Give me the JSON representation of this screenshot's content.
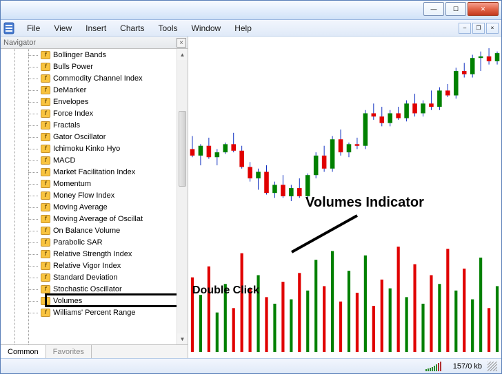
{
  "window": {
    "minimize": "—",
    "maximize": "☐",
    "close": "✕"
  },
  "menu": {
    "items": [
      "File",
      "View",
      "Insert",
      "Charts",
      "Tools",
      "Window",
      "Help"
    ]
  },
  "mdi": {
    "min": "–",
    "restore": "❐",
    "close": "×"
  },
  "navigator": {
    "title": "Navigator",
    "close": "×",
    "tabs": {
      "common": "Common",
      "favorites": "Favorites"
    },
    "indicators": [
      "Bollinger Bands",
      "Bulls Power",
      "Commodity Channel Index",
      "DeMarker",
      "Envelopes",
      "Force Index",
      "Fractals",
      "Gator Oscillator",
      "Ichimoku Kinko Hyo",
      "MACD",
      "Market Facilitation Index",
      "Momentum",
      "Money Flow Index",
      "Moving Average",
      "Moving Average of Oscillat",
      "On Balance Volume",
      "Parabolic SAR",
      "Relative Strength Index",
      "Relative Vigor Index",
      "Standard Deviation",
      "Stochastic Oscillator",
      "Volumes",
      "Williams' Percent Range"
    ],
    "selected": "Volumes"
  },
  "annotations": {
    "title": "Volumes Indicator",
    "hint": "Double Click"
  },
  "status": {
    "label": "157/0 kb"
  },
  "chart_data": [
    {
      "type": "candlestick",
      "title": "",
      "colors": {
        "up": "#008000",
        "down": "#e00000",
        "wick": "#1030c0"
      },
      "candles": [
        {
          "o": 60,
          "h": 68,
          "l": 55,
          "c": 56,
          "dir": "down"
        },
        {
          "o": 56,
          "h": 63,
          "l": 50,
          "c": 62,
          "dir": "up"
        },
        {
          "o": 62,
          "h": 67,
          "l": 54,
          "c": 55,
          "dir": "down"
        },
        {
          "o": 55,
          "h": 60,
          "l": 50,
          "c": 58,
          "dir": "up"
        },
        {
          "o": 58,
          "h": 64,
          "l": 57,
          "c": 63,
          "dir": "up"
        },
        {
          "o": 63,
          "h": 70,
          "l": 58,
          "c": 59,
          "dir": "down"
        },
        {
          "o": 59,
          "h": 62,
          "l": 48,
          "c": 49,
          "dir": "down"
        },
        {
          "o": 49,
          "h": 52,
          "l": 40,
          "c": 42,
          "dir": "down"
        },
        {
          "o": 42,
          "h": 48,
          "l": 35,
          "c": 46,
          "dir": "up"
        },
        {
          "o": 46,
          "h": 50,
          "l": 32,
          "c": 33,
          "dir": "down"
        },
        {
          "o": 33,
          "h": 40,
          "l": 30,
          "c": 38,
          "dir": "up"
        },
        {
          "o": 38,
          "h": 44,
          "l": 30,
          "c": 31,
          "dir": "down"
        },
        {
          "o": 31,
          "h": 38,
          "l": 28,
          "c": 36,
          "dir": "up"
        },
        {
          "o": 36,
          "h": 42,
          "l": 30,
          "c": 31,
          "dir": "down"
        },
        {
          "o": 31,
          "h": 45,
          "l": 29,
          "c": 44,
          "dir": "up"
        },
        {
          "o": 44,
          "h": 58,
          "l": 42,
          "c": 56,
          "dir": "up"
        },
        {
          "o": 56,
          "h": 62,
          "l": 46,
          "c": 48,
          "dir": "down"
        },
        {
          "o": 48,
          "h": 68,
          "l": 46,
          "c": 66,
          "dir": "up"
        },
        {
          "o": 66,
          "h": 72,
          "l": 56,
          "c": 58,
          "dir": "down"
        },
        {
          "o": 58,
          "h": 64,
          "l": 55,
          "c": 63,
          "dir": "up"
        },
        {
          "o": 63,
          "h": 67,
          "l": 60,
          "c": 62,
          "dir": "down"
        },
        {
          "o": 62,
          "h": 84,
          "l": 60,
          "c": 82,
          "dir": "up"
        },
        {
          "o": 82,
          "h": 88,
          "l": 78,
          "c": 80,
          "dir": "down"
        },
        {
          "o": 80,
          "h": 86,
          "l": 74,
          "c": 76,
          "dir": "down"
        },
        {
          "o": 76,
          "h": 84,
          "l": 74,
          "c": 82,
          "dir": "up"
        },
        {
          "o": 82,
          "h": 86,
          "l": 78,
          "c": 79,
          "dir": "down"
        },
        {
          "o": 79,
          "h": 90,
          "l": 77,
          "c": 88,
          "dir": "up"
        },
        {
          "o": 88,
          "h": 94,
          "l": 80,
          "c": 82,
          "dir": "down"
        },
        {
          "o": 82,
          "h": 90,
          "l": 80,
          "c": 88,
          "dir": "up"
        },
        {
          "o": 88,
          "h": 96,
          "l": 84,
          "c": 86,
          "dir": "down"
        },
        {
          "o": 86,
          "h": 98,
          "l": 84,
          "c": 96,
          "dir": "up"
        },
        {
          "o": 96,
          "h": 100,
          "l": 92,
          "c": 93,
          "dir": "down"
        },
        {
          "o": 93,
          "h": 110,
          "l": 91,
          "c": 108,
          "dir": "up"
        },
        {
          "o": 108,
          "h": 113,
          "l": 104,
          "c": 106,
          "dir": "down"
        },
        {
          "o": 106,
          "h": 118,
          "l": 104,
          "c": 116,
          "dir": "up"
        },
        {
          "o": 116,
          "h": 120,
          "l": 108,
          "c": 117,
          "dir": "up"
        },
        {
          "o": 117,
          "h": 122,
          "l": 112,
          "c": 114,
          "dir": "down"
        },
        {
          "o": 114,
          "h": 120,
          "l": 112,
          "c": 119,
          "dir": "up"
        }
      ],
      "ylim": [
        28,
        125
      ]
    },
    {
      "type": "bar",
      "title": "Volumes",
      "colors": {
        "up": "#008000",
        "down": "#e00000"
      },
      "values": [
        68,
        52,
        78,
        36,
        62,
        40,
        90,
        58,
        70,
        50,
        44,
        64,
        48,
        72,
        56,
        84,
        60,
        92,
        46,
        74,
        54,
        88,
        42,
        66,
        58,
        96,
        50,
        80,
        44,
        70,
        62,
        94,
        56,
        76,
        48,
        86,
        40,
        60
      ],
      "dirs": [
        "down",
        "up",
        "down",
        "up",
        "up",
        "down",
        "down",
        "down",
        "up",
        "down",
        "up",
        "down",
        "up",
        "down",
        "up",
        "up",
        "down",
        "up",
        "down",
        "up",
        "down",
        "up",
        "down",
        "down",
        "up",
        "down",
        "up",
        "down",
        "up",
        "down",
        "up",
        "down",
        "up",
        "down",
        "up",
        "up",
        "down",
        "up"
      ],
      "ylim": [
        0,
        100
      ]
    }
  ]
}
